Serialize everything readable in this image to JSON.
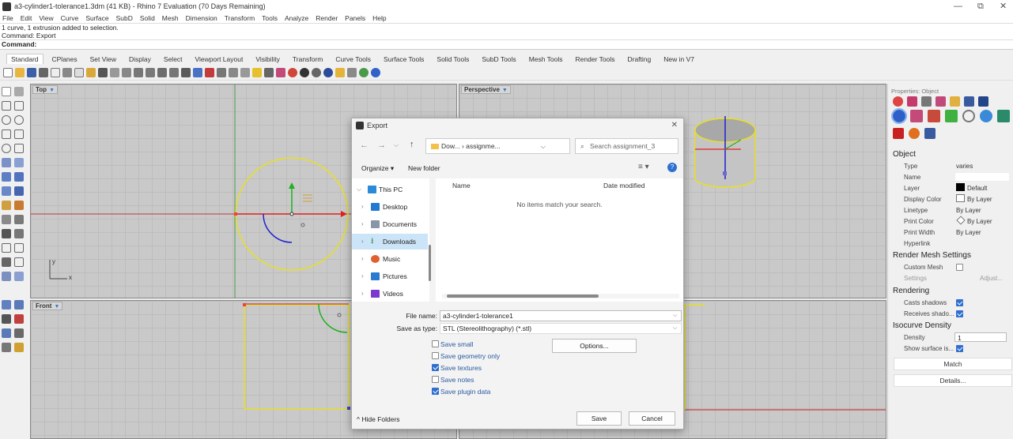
{
  "window": {
    "title": "a3-cylinder1-tolerance1.3dm (41 KB) - Rhino 7 Evaluation (70 Days Remaining)",
    "minimize": "—",
    "restore": "⧉",
    "close": "✕"
  },
  "menu": [
    "File",
    "Edit",
    "View",
    "Curve",
    "Surface",
    "SubD",
    "Solid",
    "Mesh",
    "Dimension",
    "Transform",
    "Tools",
    "Analyze",
    "Render",
    "Panels",
    "Help"
  ],
  "command_history": [
    "1 curve, 1 extrusion added to selection.",
    "Command: Export"
  ],
  "command_prompt": "Command:",
  "toolbar_tabs": [
    "Standard",
    "CPlanes",
    "Set View",
    "Display",
    "Select",
    "Viewport Layout",
    "Visibility",
    "Transform",
    "Curve Tools",
    "Surface Tools",
    "Solid Tools",
    "SubD Tools",
    "Mesh Tools",
    "Render Tools",
    "Drafting",
    "New in V7"
  ],
  "viewports": {
    "top": {
      "label": "Top",
      "axis_y": "y",
      "axis_x": "x"
    },
    "perspective": {
      "label": "Perspective"
    },
    "front": {
      "label": "Front"
    }
  },
  "properties": {
    "header": "Properties: Object",
    "object_section": "Object",
    "rows": [
      {
        "label": "Type",
        "value": "varies"
      },
      {
        "label": "Name",
        "value": ""
      },
      {
        "label": "Layer",
        "value": "Default"
      },
      {
        "label": "Display Color",
        "value": "By Layer"
      },
      {
        "label": "Linetype",
        "value": "By Layer"
      },
      {
        "label": "Print Color",
        "value": "By Layer"
      },
      {
        "label": "Print Width",
        "value": "By Layer"
      },
      {
        "label": "Hyperlink",
        "value": ""
      }
    ],
    "render_mesh_section": "Render Mesh Settings",
    "custom_mesh_label": "Custom Mesh",
    "custom_mesh_checked": false,
    "settings_label": "Settings",
    "adjust_label": "Adjust...",
    "rendering_section": "Rendering",
    "casts_shadows_label": "Casts shadows",
    "casts_shadows_checked": true,
    "receives_shadows_label": "Receives shado...",
    "receives_shadows_checked": true,
    "isocurve_section": "Isocurve Density",
    "density_label": "Density",
    "density_value": "1",
    "show_surface_label": "Show surface is...",
    "show_surface_checked": true,
    "match_button": "Match",
    "details_button": "Details..."
  },
  "dialog": {
    "title": "Export",
    "close": "✕",
    "path": "Dow... › assignme...",
    "search_placeholder": "Search assignment_3",
    "organize": "Organize ▾",
    "new_folder": "New folder",
    "tree": [
      {
        "label": "This PC",
        "icon": "pc-icon",
        "expanded": true
      },
      {
        "label": "Desktop",
        "icon": "desktop-icon"
      },
      {
        "label": "Documents",
        "icon": "documents-icon"
      },
      {
        "label": "Downloads",
        "icon": "downloads-icon",
        "selected": true
      },
      {
        "label": "Music",
        "icon": "music-icon"
      },
      {
        "label": "Pictures",
        "icon": "pictures-icon"
      },
      {
        "label": "Videos",
        "icon": "videos-icon"
      }
    ],
    "col_name": "Name",
    "col_date": "Date modified",
    "empty_message": "No items match your search.",
    "file_name_label": "File name:",
    "file_name_value": "a3-cylinder1-tolerance1",
    "save_type_label": "Save as type:",
    "save_type_value": "STL (Stereolithography) (*.stl)",
    "options_button": "Options...",
    "checkboxes": [
      {
        "label": "Save small",
        "checked": false
      },
      {
        "label": "Save geometry only",
        "checked": false
      },
      {
        "label": "Save textures",
        "checked": true
      },
      {
        "label": "Save notes",
        "checked": false
      },
      {
        "label": "Save plugin data",
        "checked": true
      }
    ],
    "hide_folders": "Hide Folders",
    "save_button": "Save",
    "cancel_button": "Cancel"
  }
}
